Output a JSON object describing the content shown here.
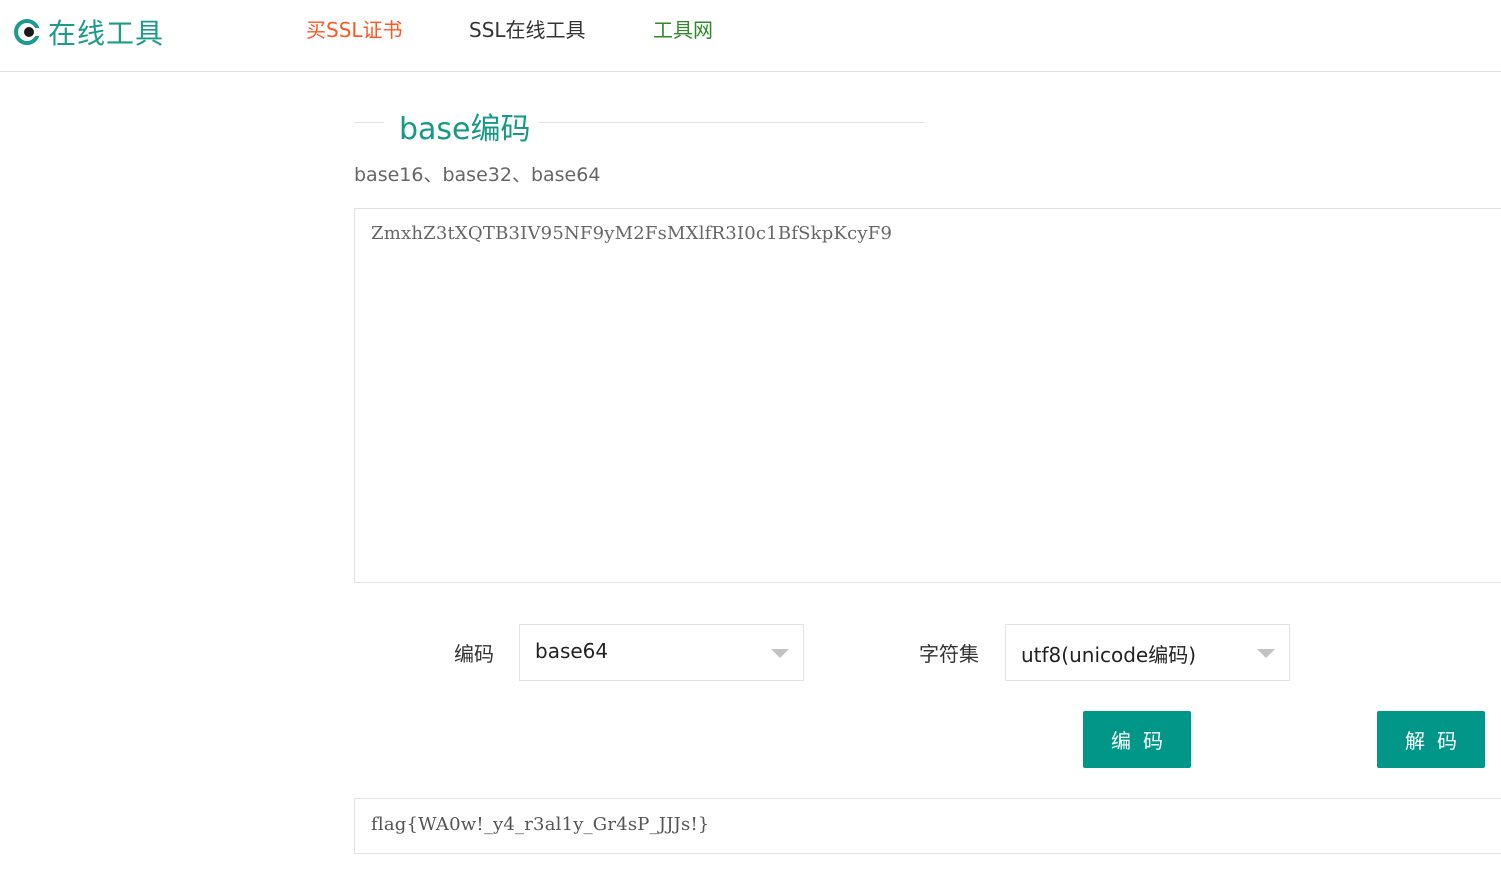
{
  "header": {
    "logo_text": "在线工具",
    "nav": [
      {
        "label": "买SSL证书",
        "color": "#ff5722"
      },
      {
        "label": "SSL在线工具",
        "color": "#333333"
      },
      {
        "label": "工具网",
        "color": "#2e8b28"
      }
    ]
  },
  "main": {
    "title": "base编码",
    "subtitle": "base16、base32、base64",
    "input_text": "ZmxhZ3tXQTB3IV95NF9yM2FsMXlfR3I0c1BfSkpKcyF9",
    "encoding_label": "编码",
    "encoding_value": "base64",
    "charset_label": "字符集",
    "charset_value": "utf8(unicode编码)",
    "encode_button": "编码",
    "decode_button": "解码",
    "output_text": "flag{WA0w!_y4_r3al1y_Gr4sP_JJJs!}"
  },
  "colors": {
    "accent": "#009688",
    "title": "#169a85",
    "logo": "#1c9b8a"
  },
  "icons": [
    "logo-icon",
    "chevron-down-icon"
  ]
}
